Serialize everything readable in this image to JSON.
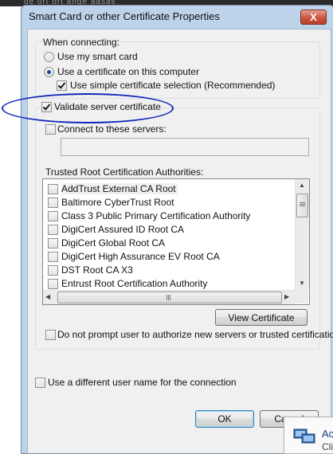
{
  "background": {
    "caption": "de ort ort ange aasas"
  },
  "dialog": {
    "title": "Smart Card or other Certificate Properties",
    "close_glyph": "X",
    "when_connecting": "When connecting:",
    "use_smart_card": "Use my smart card",
    "use_certificate": "Use a certificate on this computer",
    "simple_selection": "Use simple certificate selection (Recommended)",
    "validate_server": "Validate server certificate",
    "connect_servers": "Connect to these servers:",
    "servers_value": "",
    "trusted_root_label": "Trusted Root Certification Authorities:",
    "cas": [
      "AddTrust External CA Root",
      "Baltimore CyberTrust Root",
      "Class 3 Public Primary Certification Authority",
      "DigiCert Assured ID Root CA",
      "DigiCert Global Root CA",
      "DigiCert High Assurance EV Root CA",
      "DST Root CA X3",
      "Entrust Root Certification Authority"
    ],
    "view_certificate": "View Certificate",
    "do_not_prompt": "Do not prompt user to authorize new servers or trusted certification",
    "different_user": "Use a different user name for the connection",
    "ok": "OK",
    "cancel": "Cancel"
  },
  "popup": {
    "text_line1": "Ac",
    "text_line2": "Cli"
  },
  "state": {
    "use_smart_card": false,
    "use_certificate": true,
    "simple_selection": true,
    "validate_server": true,
    "connect_servers": false,
    "do_not_prompt": false,
    "different_user": false
  },
  "colors": {
    "annotation": "#1428b8",
    "close_button": "#c9553f"
  }
}
